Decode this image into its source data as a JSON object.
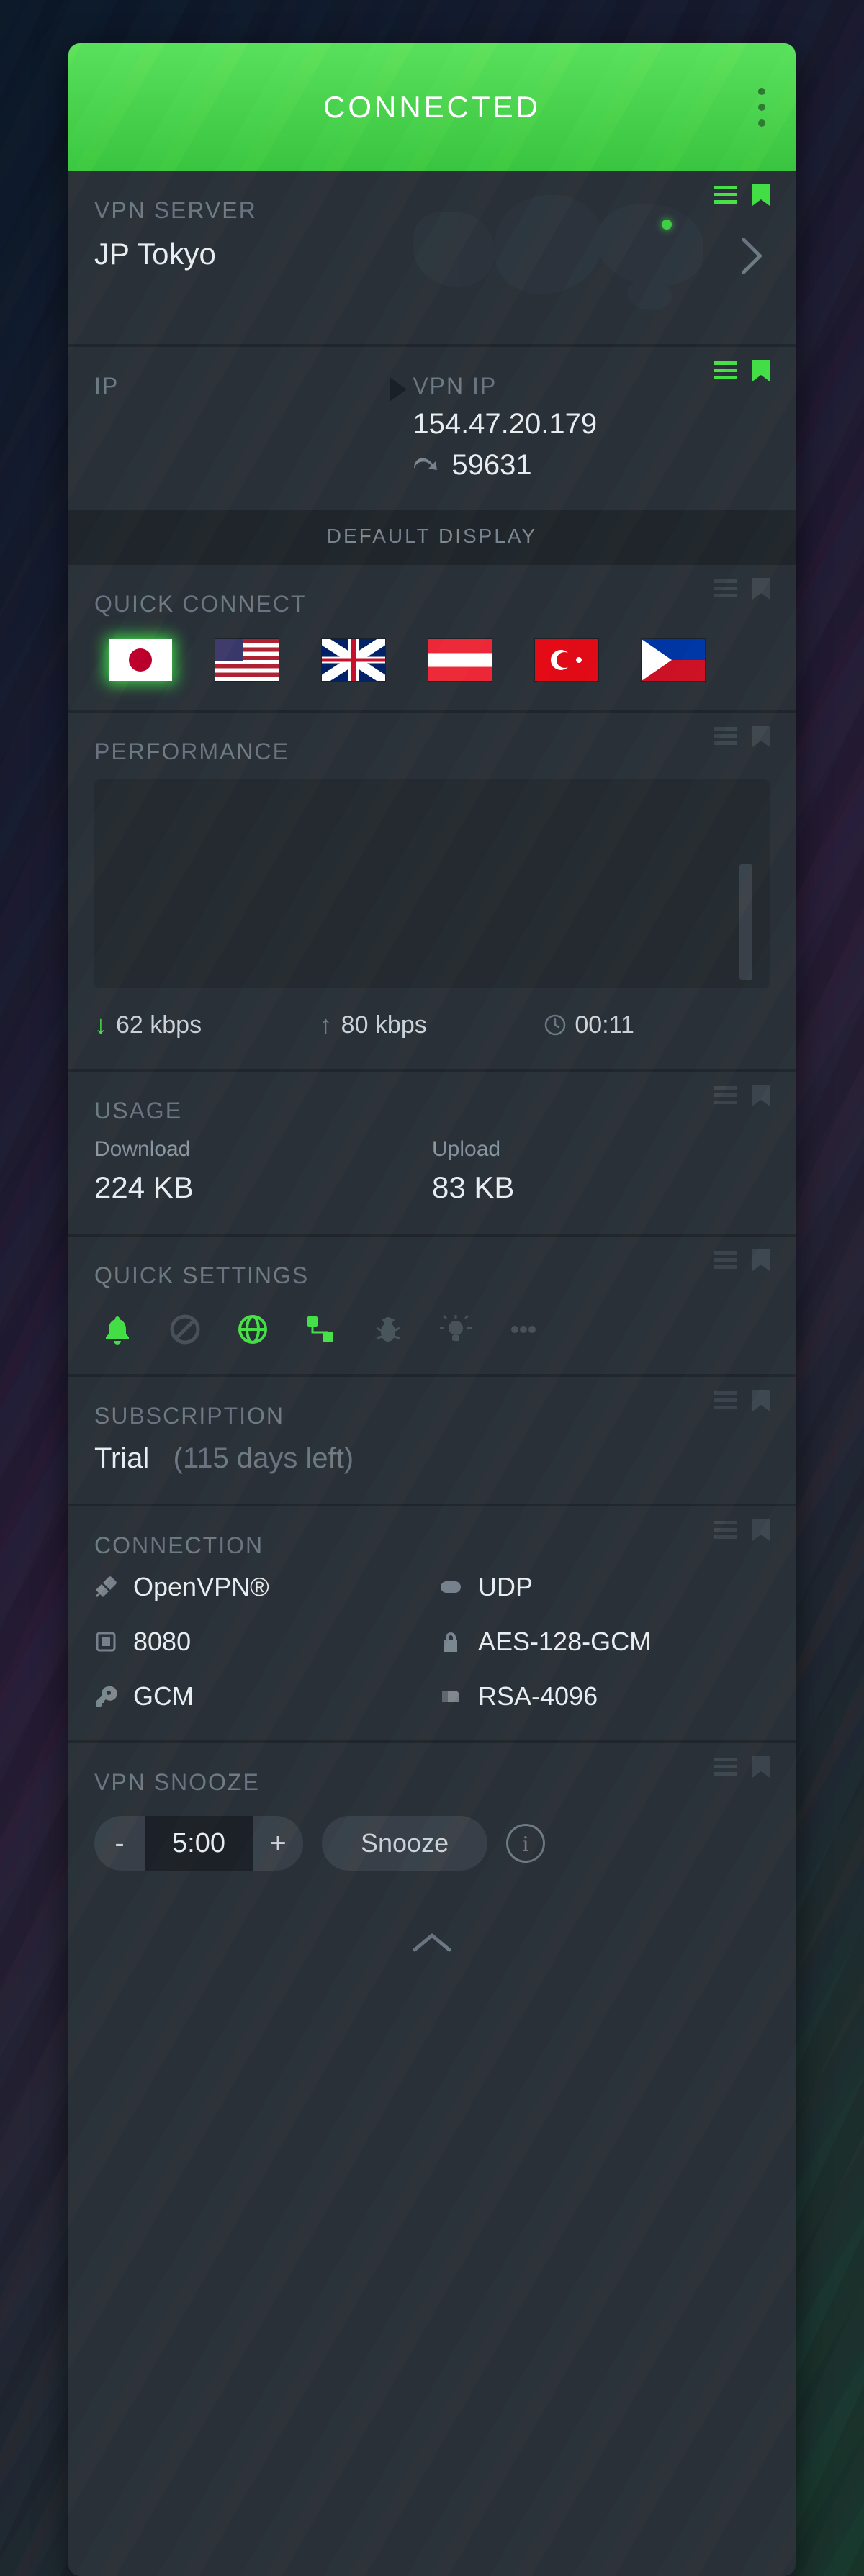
{
  "header": {
    "status": "CONNECTED"
  },
  "server": {
    "title": "VPN SERVER",
    "name": "JP Tokyo",
    "icons": {
      "list": "list-icon",
      "bookmark": "bookmark-icon"
    }
  },
  "ip": {
    "local_title": "IP",
    "vpn_title": "VPN IP",
    "vpn_ip": "154.47.20.179",
    "port": "59631"
  },
  "default_display": "DEFAULT DISPLAY",
  "quick_connect": {
    "title": "QUICK CONNECT",
    "countries": [
      {
        "code": "jp",
        "name": "Japan",
        "active": true
      },
      {
        "code": "us",
        "name": "United States",
        "active": false
      },
      {
        "code": "gb",
        "name": "United Kingdom",
        "active": false
      },
      {
        "code": "at",
        "name": "Austria",
        "active": false
      },
      {
        "code": "tr",
        "name": "Turkey",
        "active": false
      },
      {
        "code": "ph",
        "name": "Philippines",
        "active": false
      }
    ]
  },
  "performance": {
    "title": "PERFORMANCE",
    "down": "62 kbps",
    "up": "80 kbps",
    "duration": "00:11"
  },
  "usage": {
    "title": "USAGE",
    "download_label": "Download",
    "download": "224 KB",
    "upload_label": "Upload",
    "upload": "83 KB"
  },
  "quick_settings": {
    "title": "QUICK SETTINGS",
    "items": [
      {
        "name": "notifications",
        "icon": "bell",
        "active": true
      },
      {
        "name": "blocker",
        "icon": "cancel",
        "active": false
      },
      {
        "name": "network",
        "icon": "globe",
        "active": true
      },
      {
        "name": "lan",
        "icon": "lan",
        "active": true
      },
      {
        "name": "debug",
        "icon": "bug",
        "active": false
      },
      {
        "name": "light",
        "icon": "bulb",
        "active": false
      },
      {
        "name": "more",
        "icon": "dots",
        "active": false
      }
    ]
  },
  "subscription": {
    "title": "SUBSCRIPTION",
    "plan": "Trial",
    "remaining": "(115 days left)"
  },
  "connection": {
    "title": "CONNECTION",
    "items": [
      {
        "icon": "plug",
        "value": "OpenVPN®"
      },
      {
        "icon": "proto",
        "value": "UDP"
      },
      {
        "icon": "port",
        "value": "8080"
      },
      {
        "icon": "lock",
        "value": "AES-128-GCM"
      },
      {
        "icon": "key",
        "value": "GCM"
      },
      {
        "icon": "cert",
        "value": "RSA-4096"
      }
    ]
  },
  "snooze": {
    "title": "VPN SNOOZE",
    "minus": "-",
    "time": "5:00",
    "plus": "+",
    "button": "Snooze"
  },
  "colors": {
    "accent": "#46e049",
    "panel": "#2b323a"
  }
}
